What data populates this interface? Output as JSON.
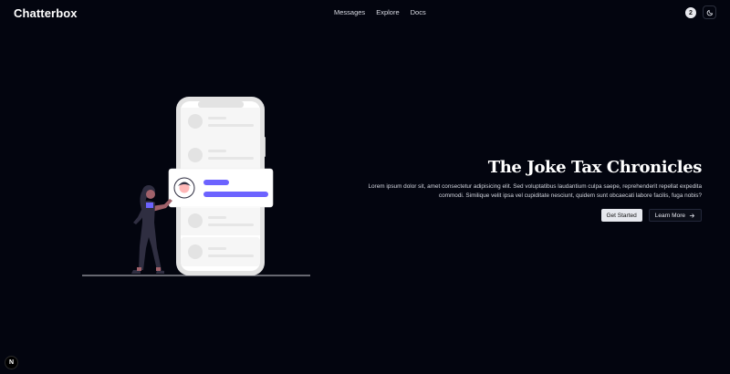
{
  "nav": {
    "brand": "Chatterbox",
    "links": [
      "Messages",
      "Explore",
      "Docs"
    ],
    "notification_count": "2",
    "theme_icon": "moon-icon"
  },
  "hero": {
    "title": "The Joke Tax Chronicles",
    "description": "Lorem ipsum dolor sit, amet consectetur adipisicing elit. Sed voluptatibus laudantium culpa saepe, reprehenderit repellat expedita commodi. Similique velit ipsa vel cupiditate nesciunt, quidem sunt obcaecati labore facilis, fuga nobis?",
    "primary_button": "Get Started",
    "secondary_button": "Learn More",
    "secondary_icon": "arrow-right-icon"
  },
  "framework_badge": "N",
  "colors": {
    "background": "#03050f",
    "accent": "#6c63ff",
    "phone": "#e6e6e6"
  }
}
